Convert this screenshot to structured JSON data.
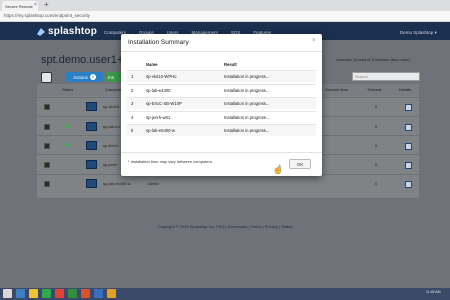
{
  "browser": {
    "tab_title": "Secure Remote",
    "tab_close": "×",
    "new_tab": "+",
    "url": "https://my.splashtop.com/endpoint_security"
  },
  "header": {
    "logo_text": "splashtop",
    "nav": [
      "Computers",
      "Groups",
      "Users",
      "Management",
      "SOS",
      "Features"
    ],
    "user_menu": "Demo Splashtop ▾"
  },
  "page": {
    "title": "spt.demo.user1+rs",
    "licenses": "Licenses: 5 used of 5 licenses (buy more)",
    "actions_label": "Actions",
    "actions_count": "0",
    "green_button_label": "Ins",
    "search_placeholder": "Search",
    "columns": {
      "status": "Status",
      "computer": "Computer",
      "session_time": "Session time",
      "threads": "Threads",
      "details": "Details"
    },
    "rows": [
      {
        "name": "sp-vkd10",
        "threads": "0",
        "online": false
      },
      {
        "name": "sp-lab-e4",
        "threads": "0",
        "online": true
      },
      {
        "name": "sp-EricC",
        "threads": "0",
        "online": true
      },
      {
        "name": "sp-jenrh",
        "threads": "0",
        "online": false
      },
      {
        "name": "sp-lab-e5400-w",
        "group": "Demo",
        "threads": "0",
        "online": false
      }
    ],
    "footer": "Copyright © 2019 Splashtop Inc. FAQ | Downloads | Terms | Privacy | Status"
  },
  "modal": {
    "title": "Installation Summary",
    "close_label": "×",
    "columns": [
      "",
      "Name",
      "Result"
    ],
    "rows": [
      {
        "index": "1",
        "name": "sp-vkd10-WPHo",
        "result": "Installation in progress..."
      },
      {
        "index": "2",
        "name": "sp-lab-e4300",
        "result": "Installation in progress..."
      },
      {
        "index": "3",
        "name": "sp-EricC-SB-W10P",
        "result": "Installation in progress..."
      },
      {
        "index": "4",
        "name": "sp-jenrh-w81",
        "result": "Installation in progress..."
      },
      {
        "index": "5",
        "name": "sp-lab-e5400-w",
        "result": "Installation in progress..."
      }
    ],
    "note": "* Installation time may vary between computers.",
    "ok_label": "OK"
  },
  "taskbar": {
    "time": "11:45 AM"
  },
  "colors": {
    "header_bg": "#1b2f4f",
    "accent_blue": "#2b7fc4",
    "online_green": "#3fae4f",
    "overlay_gray": "#6f7379"
  }
}
